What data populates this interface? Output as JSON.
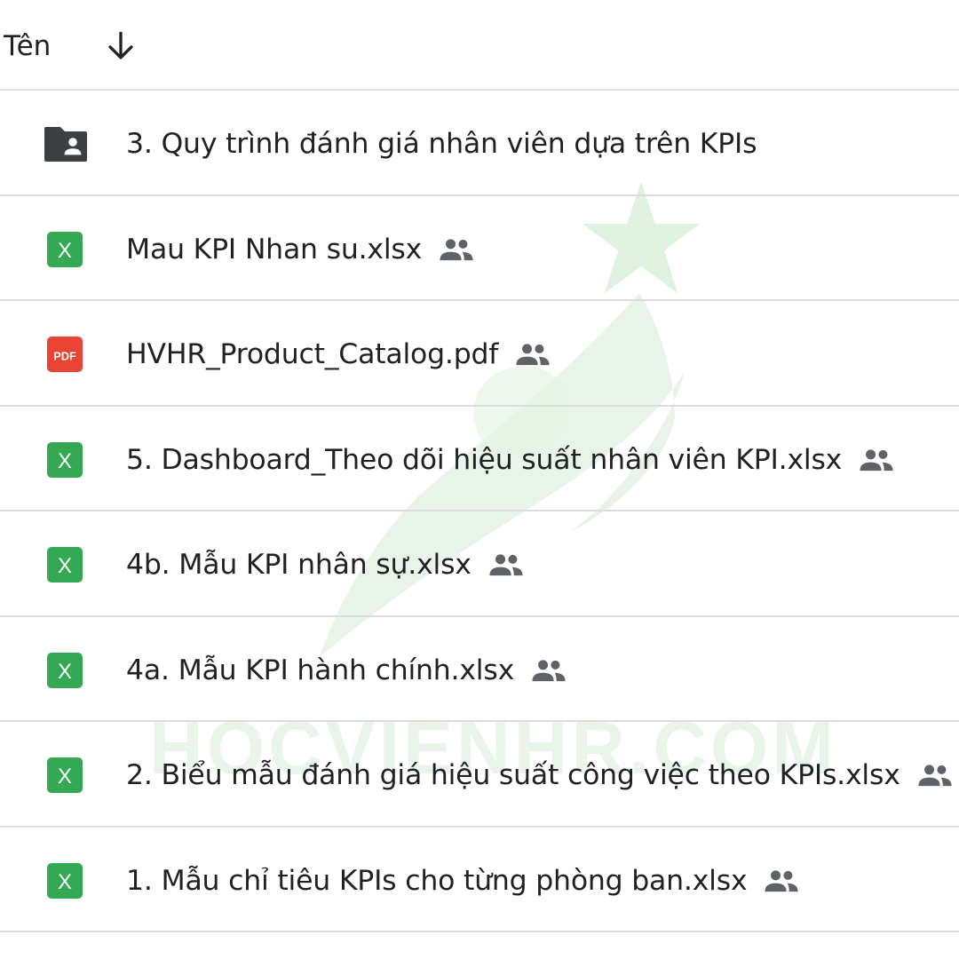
{
  "header": {
    "column_label": "Tên",
    "sort_icon": "arrow-down-icon"
  },
  "files": [
    {
      "name": "3. Quy trình đánh giá nhân viên dựa trên KPIs",
      "type": "shared-folder",
      "icon": "shared-folder-icon",
      "shared": false
    },
    {
      "name": "Mau KPI Nhan su.xlsx",
      "type": "xlsx",
      "icon": "excel-icon",
      "shared": true
    },
    {
      "name": "HVHR_Product_Catalog.pdf",
      "type": "pdf",
      "icon": "pdf-icon",
      "shared": true
    },
    {
      "name": "5. Dashboard_Theo dõi hiệu suất nhân viên KPI.xlsx",
      "type": "xlsx",
      "icon": "excel-icon",
      "shared": true
    },
    {
      "name": "4b. Mẫu KPI nhân sự.xlsx",
      "type": "xlsx",
      "icon": "excel-icon",
      "shared": true
    },
    {
      "name": "4a. Mẫu KPI hành chính.xlsx",
      "type": "xlsx",
      "icon": "excel-icon",
      "shared": true
    },
    {
      "name": "2. Biểu mẫu đánh giá hiệu suất công việc theo KPIs.xlsx",
      "type": "xlsx",
      "icon": "excel-icon",
      "shared": true
    },
    {
      "name": "1. Mẫu chỉ tiêu KPIs cho từng phòng ban.xlsx",
      "type": "xlsx",
      "icon": "excel-icon",
      "shared": true
    }
  ],
  "icon_labels": {
    "excel": "X",
    "pdf": "PDF"
  },
  "watermark": {
    "text": "HOCVIENHR.COM"
  },
  "colors": {
    "excel": "#34a853",
    "pdf": "#ea4335",
    "folder": "#3c4043",
    "text": "#202124",
    "divider": "#dadce0",
    "shared_icon": "#5f6368",
    "watermark": "#c4e2c4"
  }
}
